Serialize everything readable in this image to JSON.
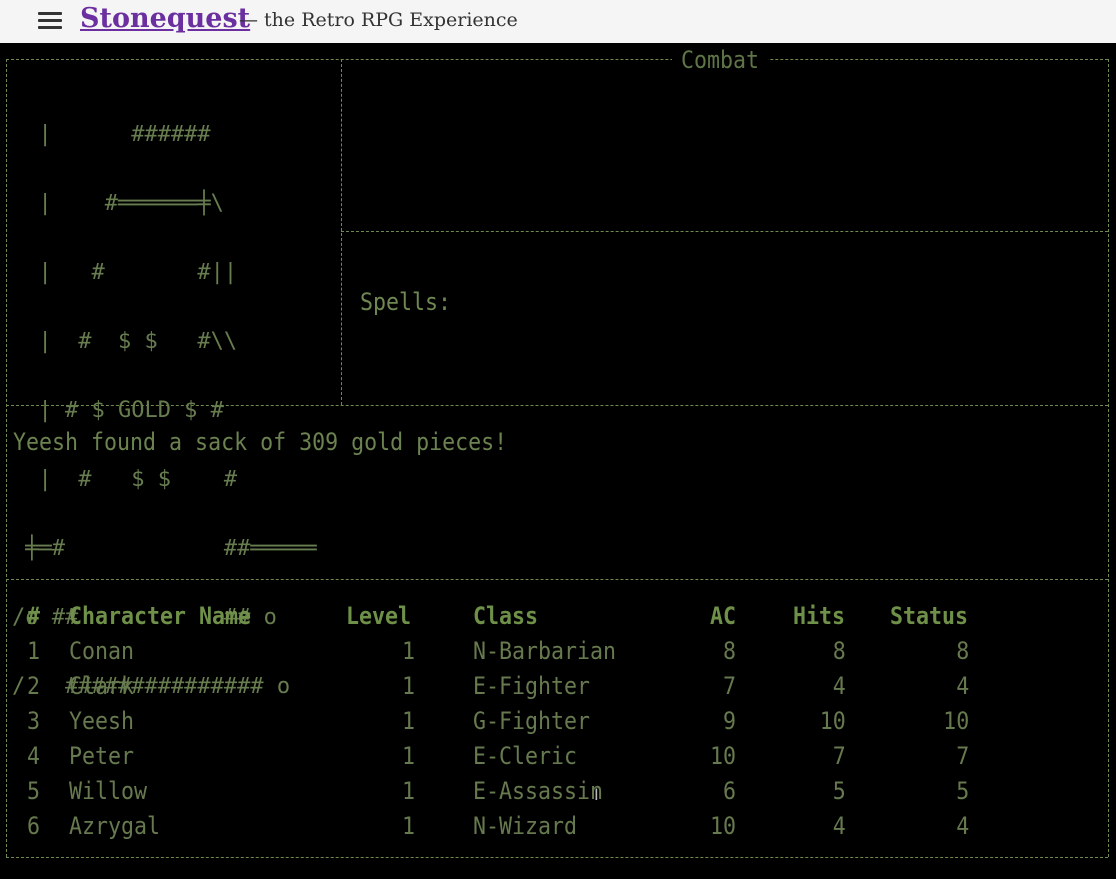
{
  "header": {
    "site_title": "Stonequest",
    "tagline": "— the Retro RPG Experience"
  },
  "panels": {
    "combat_title": "Combat",
    "spells_label": "Spells:"
  },
  "art": {
    "lines": [
      "  |      ######",
      "  |    #══════╪\\",
      "  |   #       #||",
      "  |  #  $ $   #\\\\",
      "  | # $ GOLD $ #",
      "  |  #   $ $    #",
      " ╪═#            ##═════",
      "/o ##           ## o",
      "/   ############### o"
    ]
  },
  "message": "Yeesh found a sack of 309 gold pieces!",
  "party": {
    "headers": {
      "num": "#",
      "name": "Character Name",
      "level": "Level",
      "class": "Class",
      "ac": "AC",
      "hits": "Hits",
      "status": "Status"
    },
    "rows": [
      {
        "num": "1",
        "name": "Conan",
        "level": "1",
        "class": "N-Barbarian",
        "ac": "8",
        "hits": "8",
        "status": "8"
      },
      {
        "num": "2",
        "name": "Clark",
        "level": "1",
        "class": "E-Fighter",
        "ac": "7",
        "hits": "4",
        "status": "4"
      },
      {
        "num": "3",
        "name": "Yeesh",
        "level": "1",
        "class": "G-Fighter",
        "ac": "9",
        "hits": "10",
        "status": "10"
      },
      {
        "num": "4",
        "name": "Peter",
        "level": "1",
        "class": "E-Cleric",
        "ac": "10",
        "hits": "7",
        "status": "7"
      },
      {
        "num": "5",
        "name": "Willow",
        "level": "1",
        "class": "E-Assassin",
        "ac": "6",
        "hits": "5",
        "status": "5"
      },
      {
        "num": "6",
        "name": "Azrygal",
        "level": "1",
        "class": "N-Wizard",
        "ac": "10",
        "hits": "4",
        "status": "4"
      }
    ]
  },
  "cursor_glyph": "I"
}
